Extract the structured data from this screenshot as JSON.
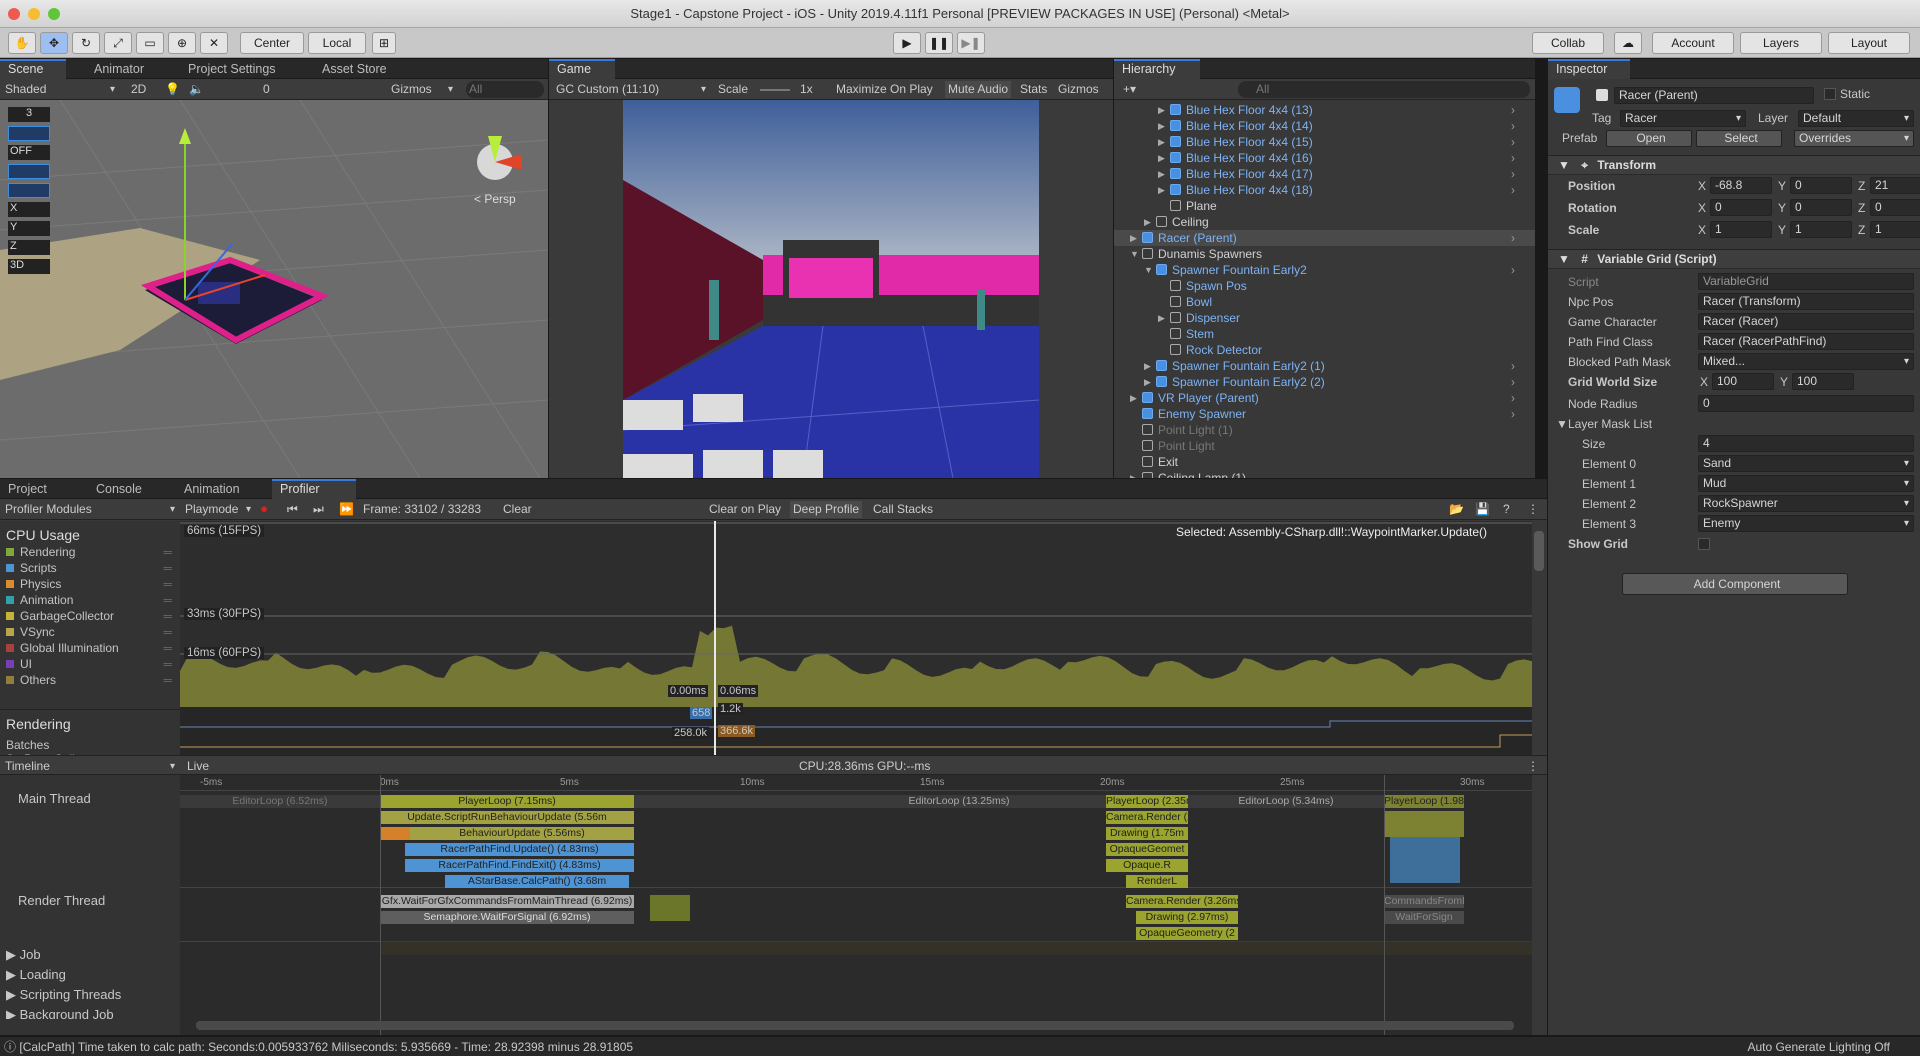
{
  "window": {
    "title": "Stage1 - Capstone Project - iOS - Unity 2019.4.11f1 Personal [PREVIEW PACKAGES IN USE] (Personal) <Metal>"
  },
  "toolbar": {
    "center": "Center",
    "local": "Local",
    "collab": "Collab",
    "account": "Account",
    "layers": "Layers",
    "layout": "Layout"
  },
  "scene": {
    "tabs": [
      "Scene",
      "Animator",
      "Project Settings",
      "Asset Store"
    ],
    "shaded": "Shaded",
    "mode2d": "2D",
    "gizmos": "Gizmos",
    "search_placeholder": "All",
    "persp": "< Persp",
    "overlay": [
      "3",
      "OFF",
      "X",
      "Y",
      "Z",
      "3D"
    ],
    "hidden_count": "0"
  },
  "game": {
    "tab": "Game",
    "display": "GC Custom (11:10)",
    "scale_label": "Scale",
    "scale_value": "1x",
    "buttons": [
      "Maximize On Play",
      "Mute Audio",
      "Stats",
      "Gizmos"
    ]
  },
  "hierarchy": {
    "tab": "Hierarchy",
    "search_placeholder": "All",
    "items": [
      {
        "label": "Blue Hex Floor 4x4 (13)",
        "indent": 4,
        "prefab": true,
        "arrow": "▶"
      },
      {
        "label": "Blue Hex Floor 4x4 (14)",
        "indent": 4,
        "prefab": true,
        "arrow": "▶"
      },
      {
        "label": "Blue Hex Floor 4x4 (15)",
        "indent": 4,
        "prefab": true,
        "arrow": "▶"
      },
      {
        "label": "Blue Hex Floor 4x4 (16)",
        "indent": 4,
        "prefab": true,
        "arrow": "▶"
      },
      {
        "label": "Blue Hex Floor 4x4 (17)",
        "indent": 4,
        "prefab": true,
        "arrow": "▶"
      },
      {
        "label": "Blue Hex Floor 4x4 (18)",
        "indent": 4,
        "prefab": true,
        "arrow": "▶"
      },
      {
        "label": "Plane",
        "indent": 4,
        "prefab": false,
        "arrow": ""
      },
      {
        "label": "Ceiling",
        "indent": 3,
        "prefab": false,
        "arrow": "▶"
      },
      {
        "label": "Racer (Parent)",
        "indent": 2,
        "prefab": true,
        "arrow": "▶",
        "selected": true
      },
      {
        "label": "Dunamis Spawners",
        "indent": 2,
        "prefab": false,
        "arrow": "▼"
      },
      {
        "label": "Spawner Fountain Early2",
        "indent": 3,
        "prefab": true,
        "arrow": "▼"
      },
      {
        "label": "Spawn Pos",
        "indent": 4,
        "prefab": false,
        "arrow": "",
        "blue": true
      },
      {
        "label": "Bowl",
        "indent": 4,
        "prefab": false,
        "arrow": "",
        "blue": true
      },
      {
        "label": "Dispenser",
        "indent": 4,
        "prefab": false,
        "arrow": "▶",
        "blue": true
      },
      {
        "label": "Stem",
        "indent": 4,
        "prefab": false,
        "arrow": "",
        "blue": true
      },
      {
        "label": "Rock Detector",
        "indent": 4,
        "prefab": false,
        "arrow": "",
        "blue": true
      },
      {
        "label": "Spawner Fountain Early2 (1)",
        "indent": 3,
        "prefab": true,
        "arrow": "▶"
      },
      {
        "label": "Spawner Fountain Early2 (2)",
        "indent": 3,
        "prefab": true,
        "arrow": "▶"
      },
      {
        "label": "VR Player (Parent)",
        "indent": 2,
        "prefab": true,
        "arrow": "▶"
      },
      {
        "label": "Enemy Spawner",
        "indent": 2,
        "prefab": true,
        "arrow": ""
      },
      {
        "label": "Point Light (1)",
        "indent": 2,
        "prefab": false,
        "arrow": "",
        "dim": true
      },
      {
        "label": "Point Light",
        "indent": 2,
        "prefab": false,
        "arrow": "",
        "dim": true
      },
      {
        "label": "Exit",
        "indent": 2,
        "prefab": false,
        "arrow": ""
      },
      {
        "label": "Ceiling Lamp (1)",
        "indent": 2,
        "prefab": false,
        "arrow": "▶"
      }
    ]
  },
  "inspector": {
    "tab": "Inspector",
    "object_name": "Racer (Parent)",
    "static": "Static",
    "tag_label": "Tag",
    "tag": "Racer",
    "layer_label": "Layer",
    "layer": "Default",
    "prefab_label": "Prefab",
    "open": "Open",
    "select": "Select",
    "overrides": "Overrides",
    "transform": {
      "title": "Transform",
      "rows": [
        {
          "label": "Position",
          "x": "-68.8",
          "y": "0",
          "z": "21"
        },
        {
          "label": "Rotation",
          "x": "0",
          "y": "0",
          "z": "0"
        },
        {
          "label": "Scale",
          "x": "1",
          "y": "1",
          "z": "1"
        }
      ]
    },
    "script": {
      "title": "Variable Grid (Script)",
      "script_label": "Script",
      "script_value": "VariableGrid",
      "npc_label": "Npc Pos",
      "npc_value": "Racer (Transform)",
      "gc_label": "Game Character",
      "gc_value": "Racer (Racer)",
      "pf_label": "Path Find Class",
      "pf_value": "Racer (RacerPathFind)",
      "bpm_label": "Blocked Path Mask",
      "bpm_value": "Mixed...",
      "gws_label": "Grid World Size",
      "gws_x": "100",
      "gws_y": "100",
      "nr_label": "Node Radius",
      "nr_value": "0",
      "lml_label": "Layer Mask List",
      "size_label": "Size",
      "size_value": "4",
      "elements": [
        {
          "label": "Element 0",
          "value": "Sand"
        },
        {
          "label": "Element 1",
          "value": "Mud"
        },
        {
          "label": "Element 2",
          "value": "RockSpawner"
        },
        {
          "label": "Element 3",
          "value": "Enemy"
        }
      ],
      "showgrid_label": "Show Grid"
    },
    "add_component": "Add Component"
  },
  "bottom_tabs": [
    "Project",
    "Console",
    "Animation",
    "Profiler"
  ],
  "profiler": {
    "modules": "Profiler Modules",
    "playmode": "Playmode",
    "frame": "Frame: 33102 / 33283",
    "clear": "Clear",
    "clear_on_play": "Clear on Play",
    "deep_profile": "Deep Profile",
    "call_stacks": "Call Stacks",
    "cpu_title": "CPU Usage",
    "legend": [
      {
        "name": "Rendering",
        "color": "#80a83c"
      },
      {
        "name": "Scripts",
        "color": "#4e93d4"
      },
      {
        "name": "Physics",
        "color": "#d98c2b"
      },
      {
        "name": "Animation",
        "color": "#34a0a8"
      },
      {
        "name": "GarbageCollector",
        "color": "#c8b33a"
      },
      {
        "name": "VSync",
        "color": "#b8a64a"
      },
      {
        "name": "Global Illumination",
        "color": "#a8413d"
      },
      {
        "name": "UI",
        "color": "#7a3fb6"
      },
      {
        "name": "Others",
        "color": "#8f7e3f"
      }
    ],
    "rendering_title": "Rendering",
    "rendering_items": [
      "Batches",
      "SetPass Calls"
    ],
    "fps_labels": [
      "66ms (15FPS)",
      "33ms (30FPS)",
      "16ms (60FPS)"
    ],
    "selected": "Selected: Assembly-CSharp.dll!::WaypointMarker.Update()",
    "tooltips": [
      "0.00ms",
      "0.06ms",
      "658",
      "1.2k",
      "258.0k",
      "366.6k"
    ],
    "timeline": "Timeline",
    "live": "Live",
    "cpu_gpu": "CPU:28.36ms   GPU:--ms",
    "ticks": [
      "-5ms",
      "0ms",
      "5ms",
      "10ms",
      "15ms",
      "20ms",
      "25ms",
      "30ms"
    ],
    "threads": [
      "Main Thread",
      "Render Thread"
    ],
    "groups": [
      "Job",
      "Loading",
      "Scripting Threads",
      "Background Job"
    ],
    "bars": {
      "editorloop1": "EditorLoop (6.52ms)",
      "playerloop": "PlayerLoop (7.15ms)",
      "sbu": "Update.ScriptRunBehaviourUpdate (5.56m",
      "bu": "BehaviourUpdate (5.56ms)",
      "rpu": "RacerPathFind.Update() (4.83ms)",
      "rpf": "RacerPathFind.FindExit() (4.83ms)",
      "asc": "AStarBase.CalcPath() (3.68m",
      "editorloop2": "EditorLoop (13.25ms)",
      "playerloop2": "PlayerLoop (2.35m",
      "cr": "Camera.Render (2.2",
      "dr": "Drawing (1.75m",
      "og": "OpaqueGeomet",
      "op": "Opaque.R",
      "rl": "RenderL",
      "editorloop3": "EditorLoop (5.34ms)",
      "playerloop3": "PlayerLoop (1.98",
      "wait": "Gfx.WaitForGfxCommandsFromMainThread (6.92ms)",
      "sem": "Semaphore.WaitForSignal (6.92ms)",
      "camr": "Camera.Render (3.26ms)",
      "draw2": "Drawing (2.97ms)",
      "og2": "OpaqueGeometry (2",
      "cmd2": "CommandsFromM",
      "wfs": "WaitForSign"
    }
  },
  "status": {
    "message": "[CalcPath] Time taken to calc path: Seconds:0.005933762 Miliseconds: 5.935669 - Time: 28.92398 minus 28.91805",
    "right": "Auto Generate Lighting Off"
  }
}
